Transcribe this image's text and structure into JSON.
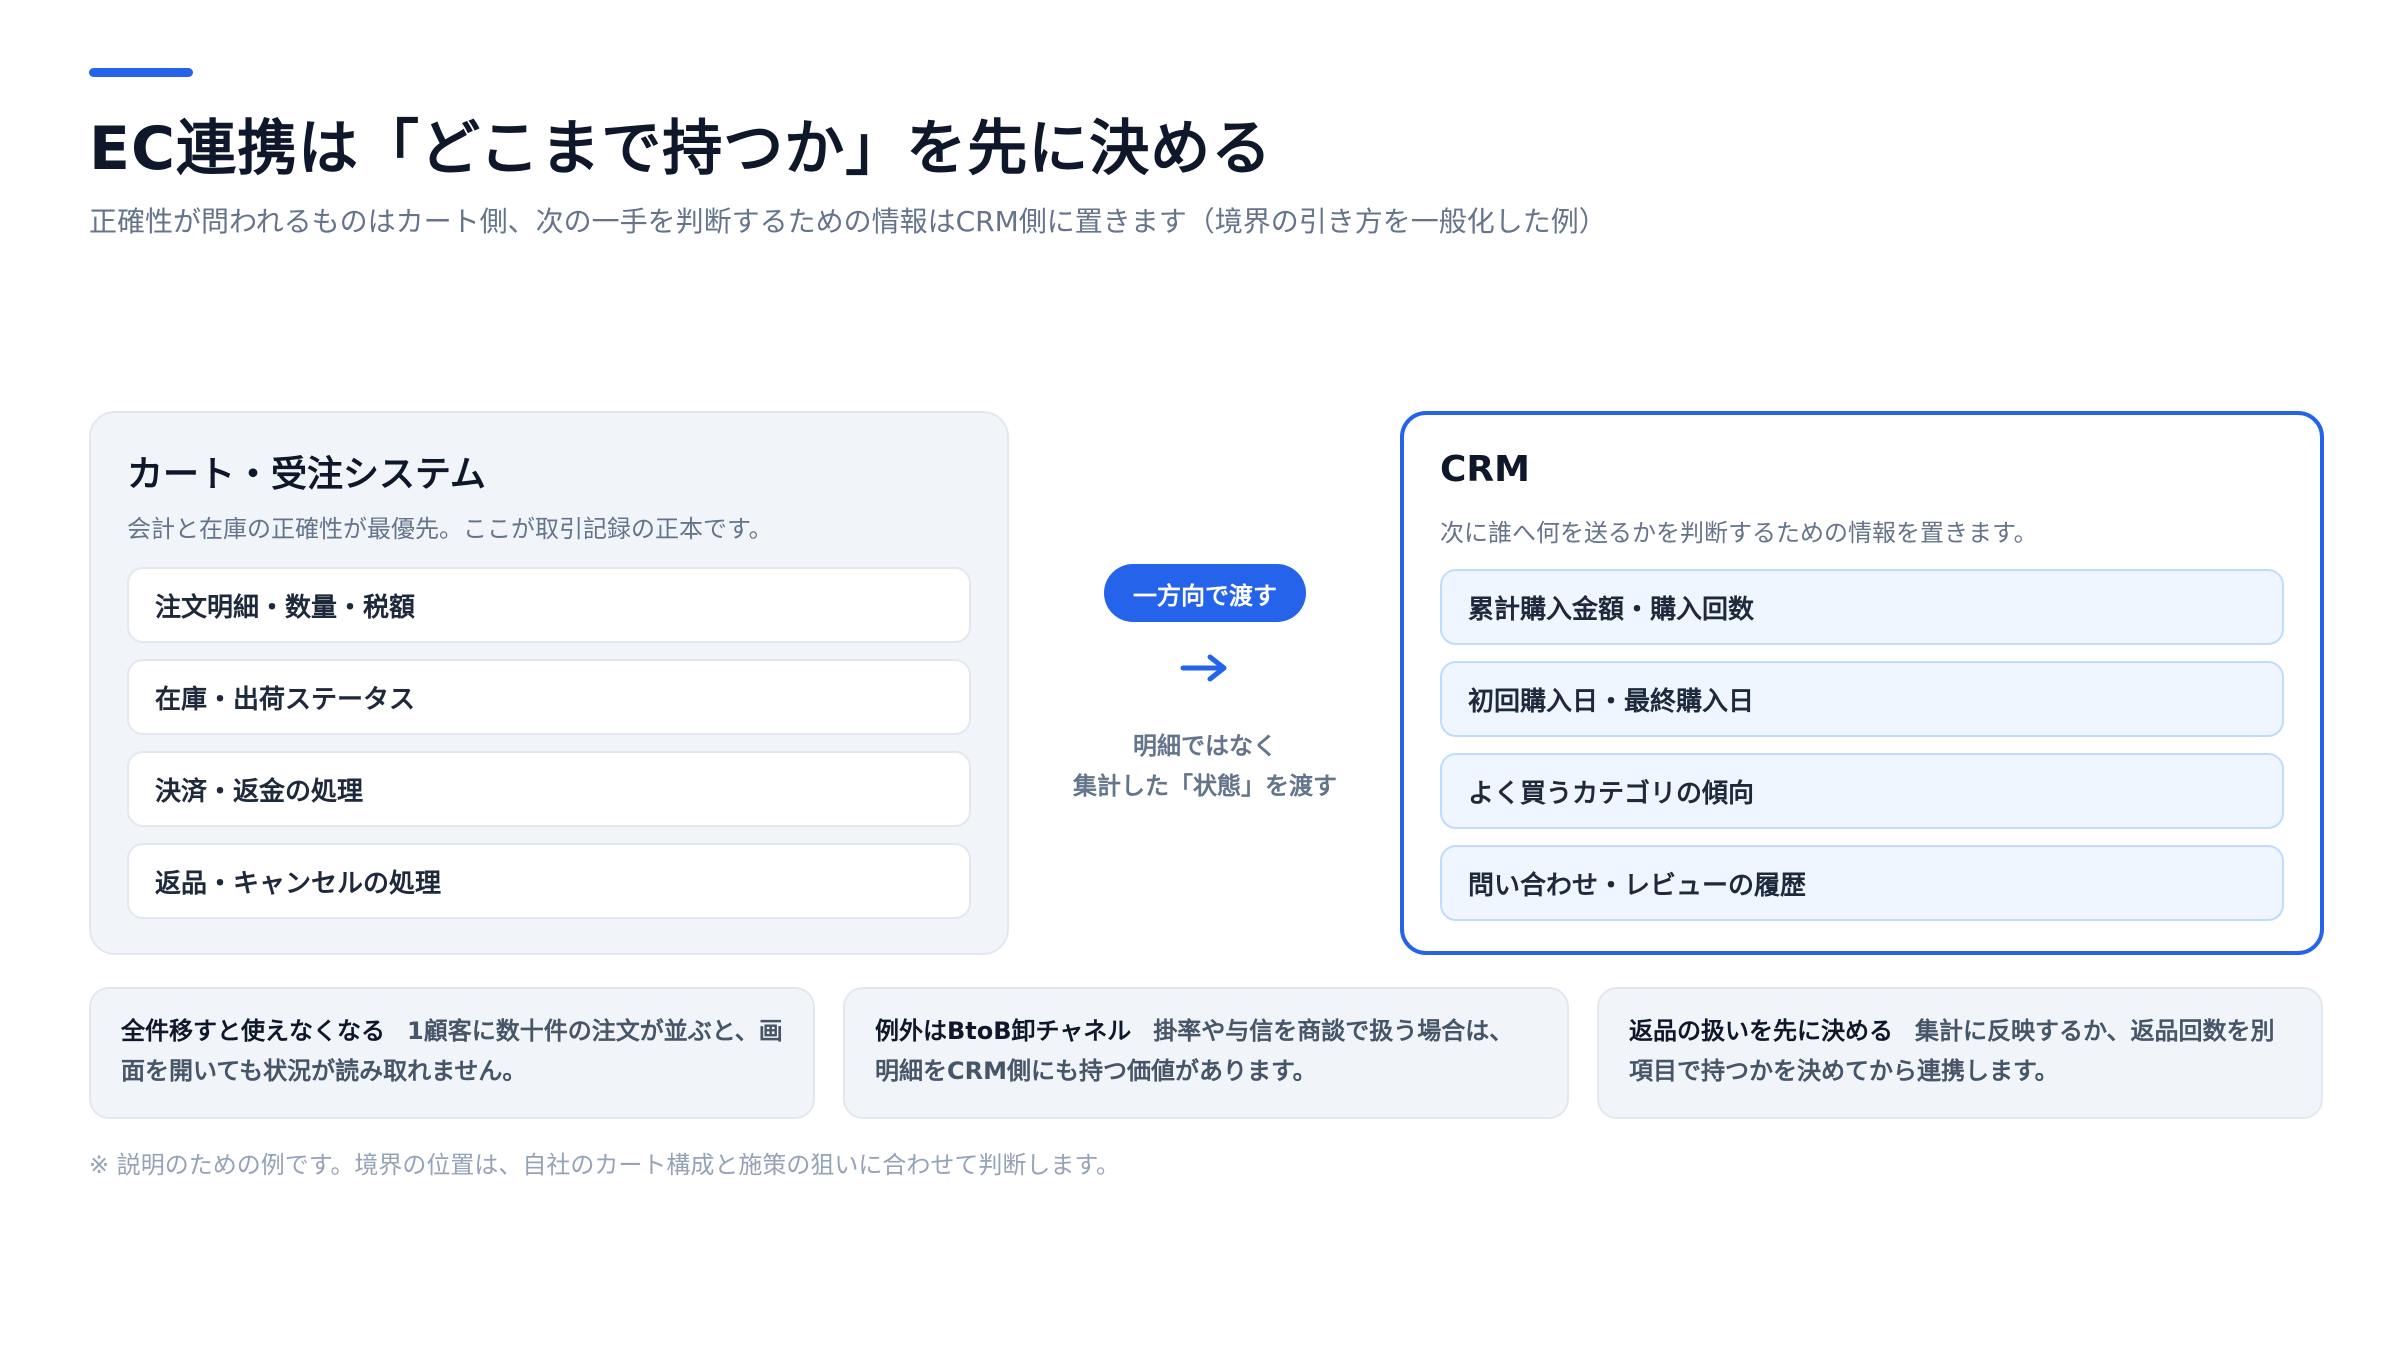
{
  "header": {
    "title": "EC連携は「どこまで持つか」を先に決める",
    "subtitle": "正確性が問われるものはカート側、次の一手を判断するための情報はCRM側に置きます（境界の引き方を一般化した例）"
  },
  "left_panel": {
    "title": "カート・受注システム",
    "description": "会計と在庫の正確性が最優先。ここが取引記録の正本です。",
    "items": [
      "注文明細・数量・税額",
      "在庫・出荷ステータス",
      "決済・返金の処理",
      "返品・キャンセルの処理"
    ]
  },
  "flow": {
    "badge": "一方向で渡す",
    "note_line1": "明細ではなく",
    "note_line2": "集計した「状態」を渡す"
  },
  "right_panel": {
    "title": "CRM",
    "description": "次に誰へ何を送るかを判断するための情報を置きます。",
    "items": [
      "累計購入金額・購入回数",
      "初回購入日・最終購入日",
      "よく買うカテゴリの傾向",
      "問い合わせ・レビューの履歴"
    ]
  },
  "cards": [
    {
      "heading": "全件移すと使えなくなる",
      "body": "1顧客に数十件の注文が並ぶと、画面を開いても状況が読み取れません。"
    },
    {
      "heading": "例外はBtoB卸チャネル",
      "body": "掛率や与信を商談で扱う場合は、明細をCRM側にも持つ価値があります。"
    },
    {
      "heading": "返品の扱いを先に決める",
      "body": "集計に反映するか、返品回数を別項目で持つかを決めてから連携します。"
    }
  ],
  "footnote": "※ 説明のための例です。境界の位置は、自社のカート構成と施策の狙いに合わせて判断します。",
  "colors": {
    "accent": "#2563eb",
    "panel_bg": "#f1f5f9",
    "crm_item_bg": "#eff6ff"
  },
  "icons": {
    "flow_arrow": "arrow-right-icon"
  }
}
